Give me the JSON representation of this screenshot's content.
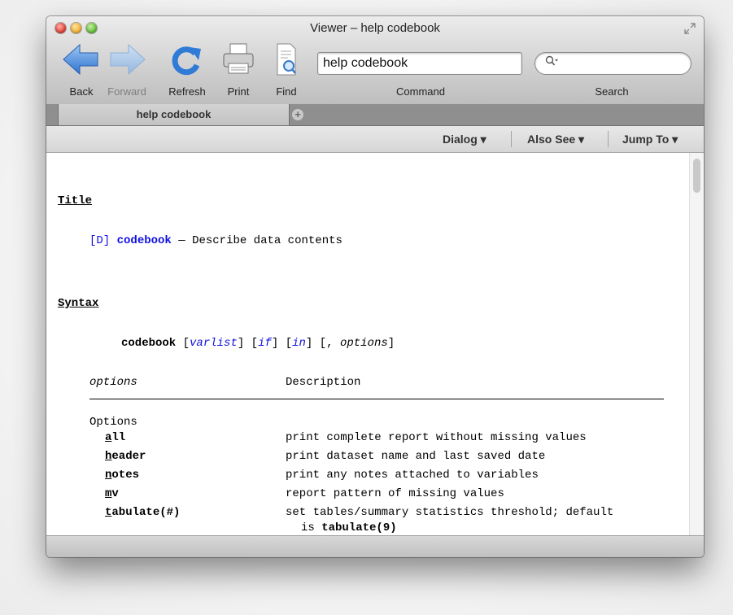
{
  "window": {
    "title": "Viewer – help codebook"
  },
  "toolbar": {
    "back_label": "Back",
    "forward_label": "Forward",
    "refresh_label": "Refresh",
    "print_label": "Print",
    "find_label": "Find",
    "command_value": "help codebook",
    "command_label": "Command",
    "search_value": "",
    "search_label": "Search"
  },
  "tabs": [
    {
      "label": "help codebook"
    }
  ],
  "menu": {
    "dialog": "Dialog ▾",
    "also_see": "Also See ▾",
    "jump_to": "Jump To ▾"
  },
  "help": {
    "title_heading": "Title",
    "manual_ref": "[D]",
    "command_name": "codebook",
    "dash": "—",
    "description": "Describe data contents",
    "syntax_heading": "Syntax",
    "syntax": {
      "cmd": "codebook",
      "lb1": "[",
      "varlist": "varlist",
      "rb1": "]",
      "lb2": "[",
      "if": "if",
      "rb2": "]",
      "lb3": "[",
      "in": "in",
      "rb3": "]",
      "tail_open": "[, ",
      "options": "options",
      "tail_close": "]"
    },
    "table": {
      "col_options": "options",
      "col_description": "Description",
      "group": "Options",
      "rows": [
        {
          "first": "a",
          "rest": "ll",
          "desc": "print complete report without missing values"
        },
        {
          "first": "h",
          "rest": "eader",
          "desc": "print dataset name and last saved date"
        },
        {
          "first": "n",
          "rest": "otes",
          "desc": "print any notes attached to variables"
        },
        {
          "first": "m",
          "rest": "v",
          "desc": "report pattern of missing values"
        },
        {
          "first": "t",
          "rest": "abulate(#)",
          "desc": "set tables/summary statistics threshold; default"
        }
      ],
      "wrap_prefix": "is ",
      "wrap_bold": "tabulate(9)"
    }
  }
}
